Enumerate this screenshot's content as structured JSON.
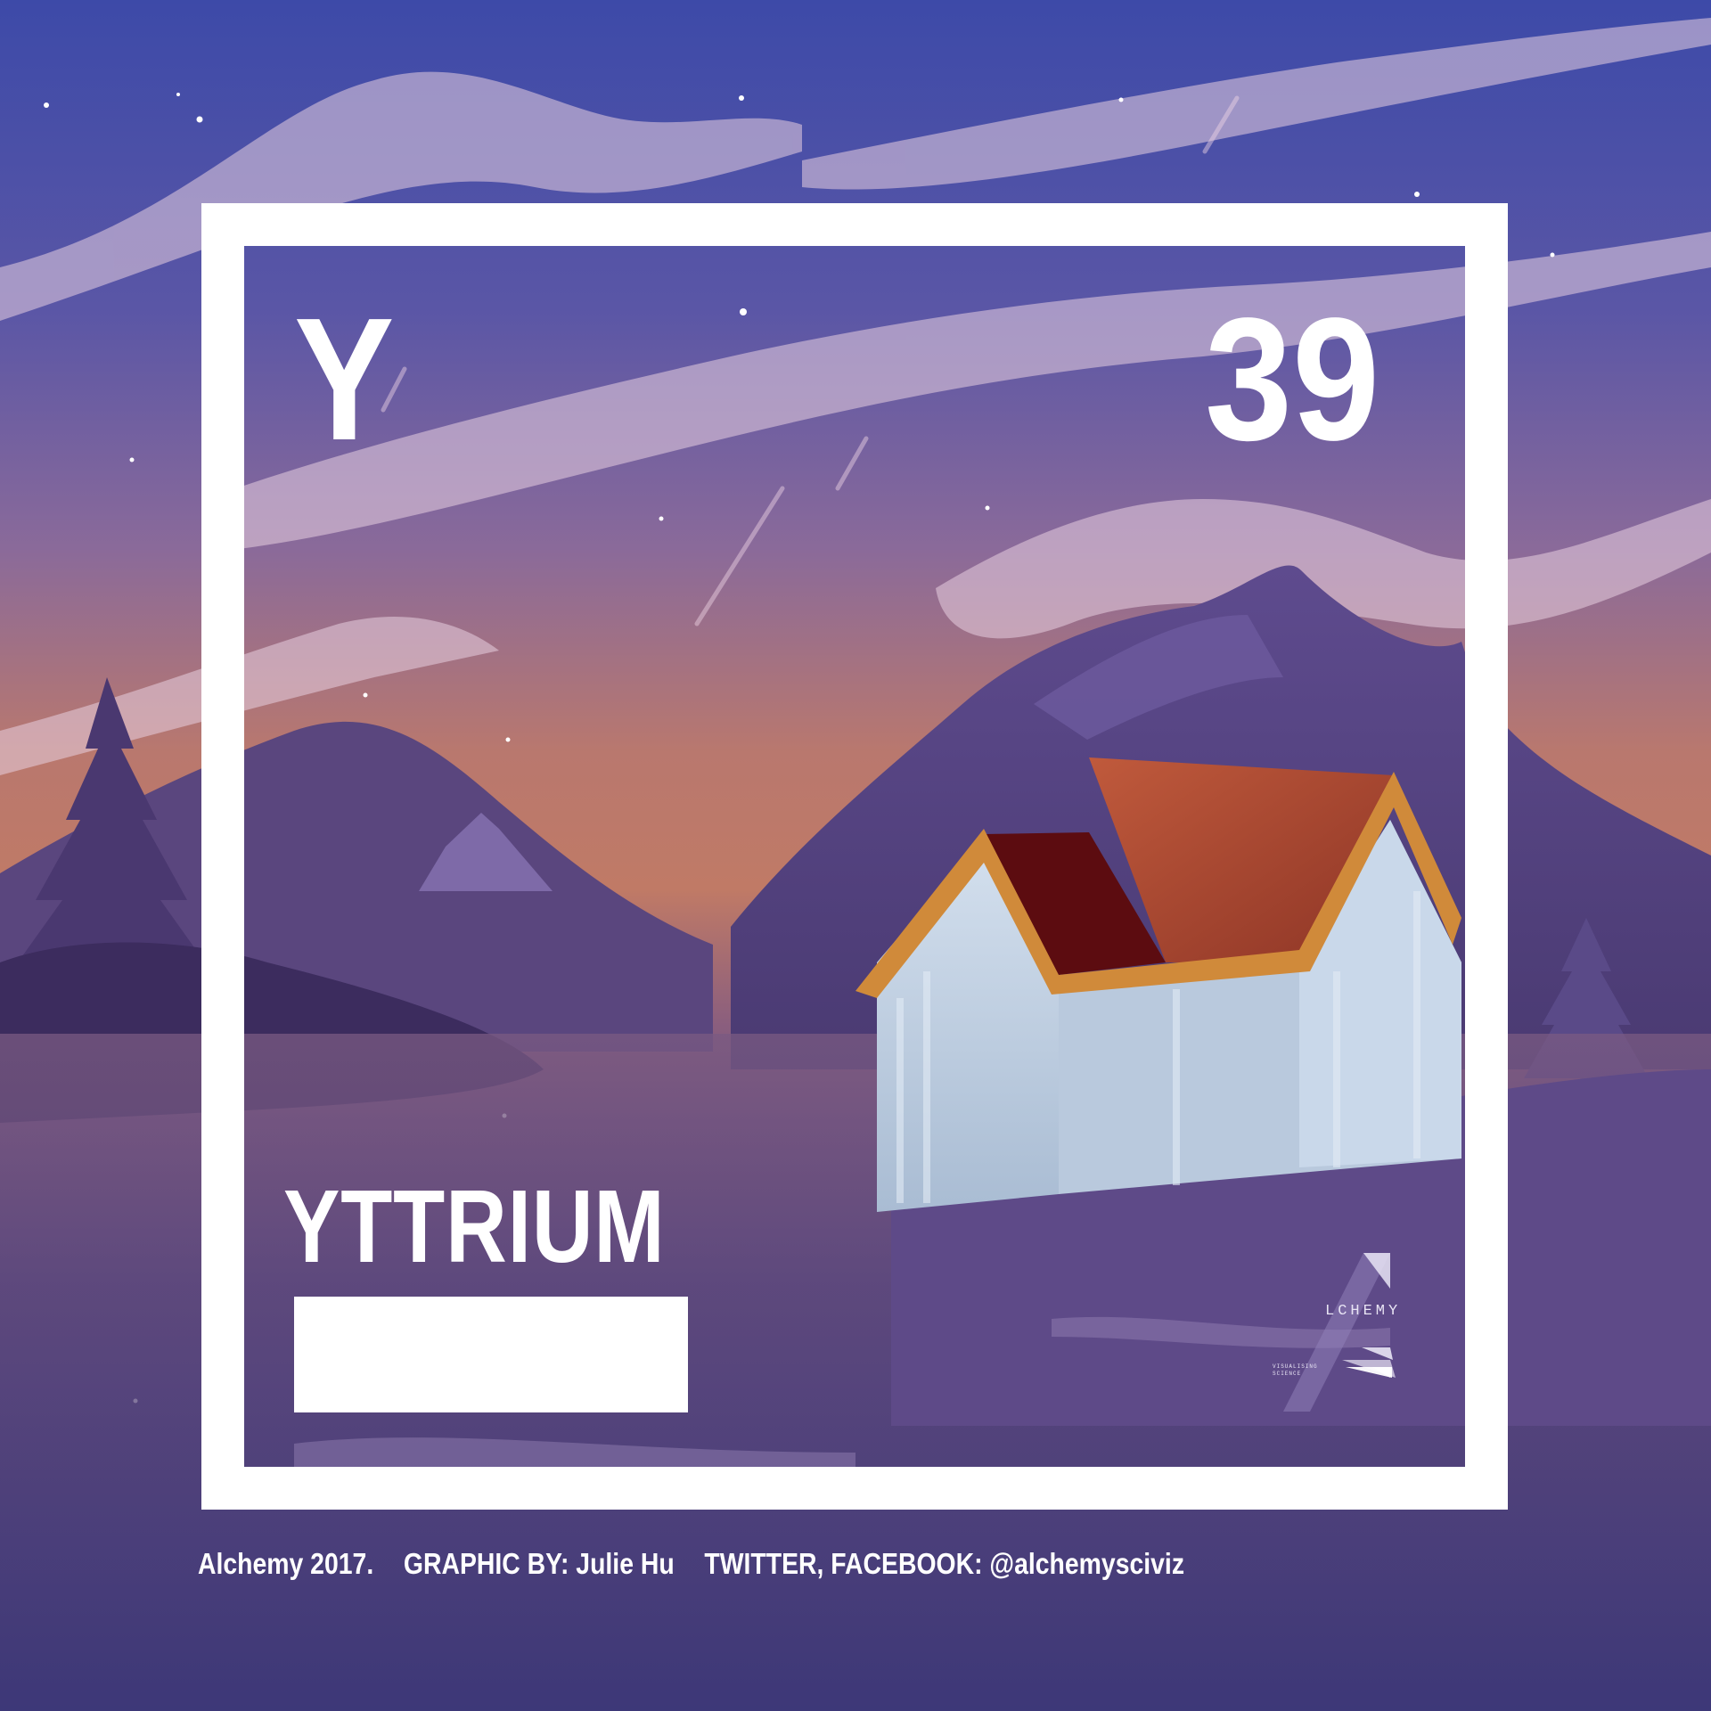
{
  "card": {
    "symbol": "Y",
    "atomic_number": "39",
    "name": "YTTRIUM"
  },
  "logo": {
    "word": "LCHEMY",
    "tagline_line1": "VISUALISING",
    "tagline_line2": "SCIENCE",
    "icon": "alchemy-a-logo"
  },
  "credits": {
    "year": "Alchemy 2017.",
    "graphic_by": "GRAPHIC BY: Julie Hu",
    "social": "TWITTER, FACEBOOK: @alchemysciviz"
  },
  "colors": {
    "sky_top": "#3e4aa6",
    "sky_mid": "#8a6592",
    "sky_glow": "#c07a68",
    "mountain": "#5a3f7e",
    "roof": "#b04530",
    "wall": "#c4d3e6",
    "frame": "#ffffff"
  }
}
